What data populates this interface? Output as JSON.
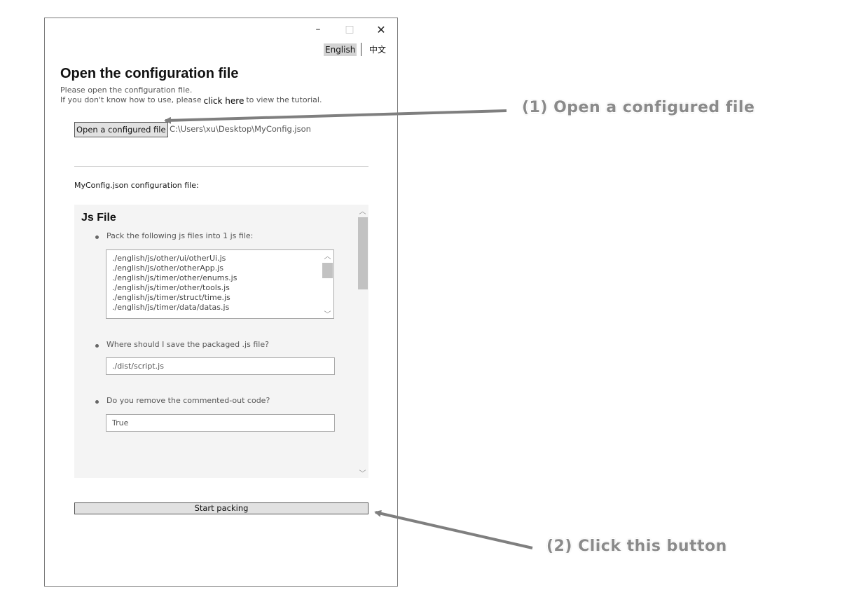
{
  "window": {
    "minimize_glyph": "–",
    "maximize_glyph": "□",
    "close_glyph": "✕"
  },
  "language": {
    "english": "English",
    "chinese": "中文"
  },
  "header": {
    "title": "Open the configuration file",
    "subtitle": "Please open the configuration file.",
    "tutorial_prefix": "If you don't know how to use, please",
    "tutorial_link": "click here",
    "tutorial_suffix": "to view the tutorial."
  },
  "open": {
    "button_label": "Open a configured file",
    "path": "C:\\Users\\xu\\Desktop\\MyConfig.json"
  },
  "config": {
    "label": "MyConfig.json configuration file:",
    "section_title": "Js File",
    "q1": "Pack the following js files into 1 js file:",
    "files": [
      "./english/js/other/ui/otherUi.js",
      "./english/js/other/otherApp.js",
      "./english/js/timer/other/enums.js",
      "./english/js/timer/other/tools.js",
      "./english/js/timer/struct/time.js",
      "./english/js/timer/data/datas.js"
    ],
    "q2": "Where should I save the packaged .js file?",
    "save_path": "./dist/script.js",
    "q3": "Do you remove the commented-out code?",
    "remove_comments": "True"
  },
  "actions": {
    "start_label": "Start packing"
  },
  "annotations": {
    "step1": "(1) Open a configured file",
    "step2": "(2) Click this button"
  },
  "colors": {
    "annotation": "#8a8a8a",
    "button_bg": "#e1e1e1",
    "panel_bg": "#f4f4f4"
  }
}
